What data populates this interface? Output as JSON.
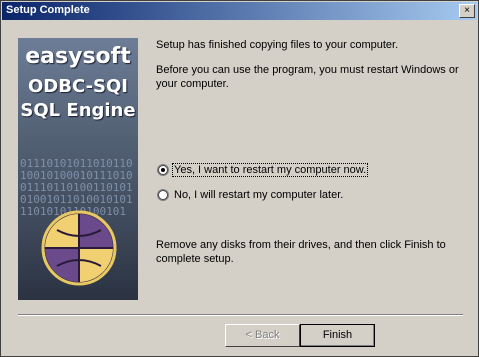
{
  "window": {
    "title": "Setup Complete",
    "close_glyph": "×"
  },
  "banner": {
    "brand_line1": "easysoft",
    "brand_line2": "ODBC-SQI",
    "brand_line3": "SQL Engine",
    "binary_text": "011101010110101101001010001011101001110110100110101010010110100101011101010110100101",
    "logo_icon": "globe-logo-icon"
  },
  "content": {
    "finished_text": "Setup has finished copying files to your computer.",
    "restart_text": "Before you can use the program, you must restart Windows or your computer.",
    "options": [
      {
        "label": "Yes, I want to restart my computer now.",
        "selected": true
      },
      {
        "label": "No, I will restart my computer later.",
        "selected": false
      }
    ],
    "remove_disks_text": "Remove any disks from their drives, and then click Finish to complete setup."
  },
  "buttons": {
    "back_label": "< Back",
    "finish_label": "Finish"
  }
}
